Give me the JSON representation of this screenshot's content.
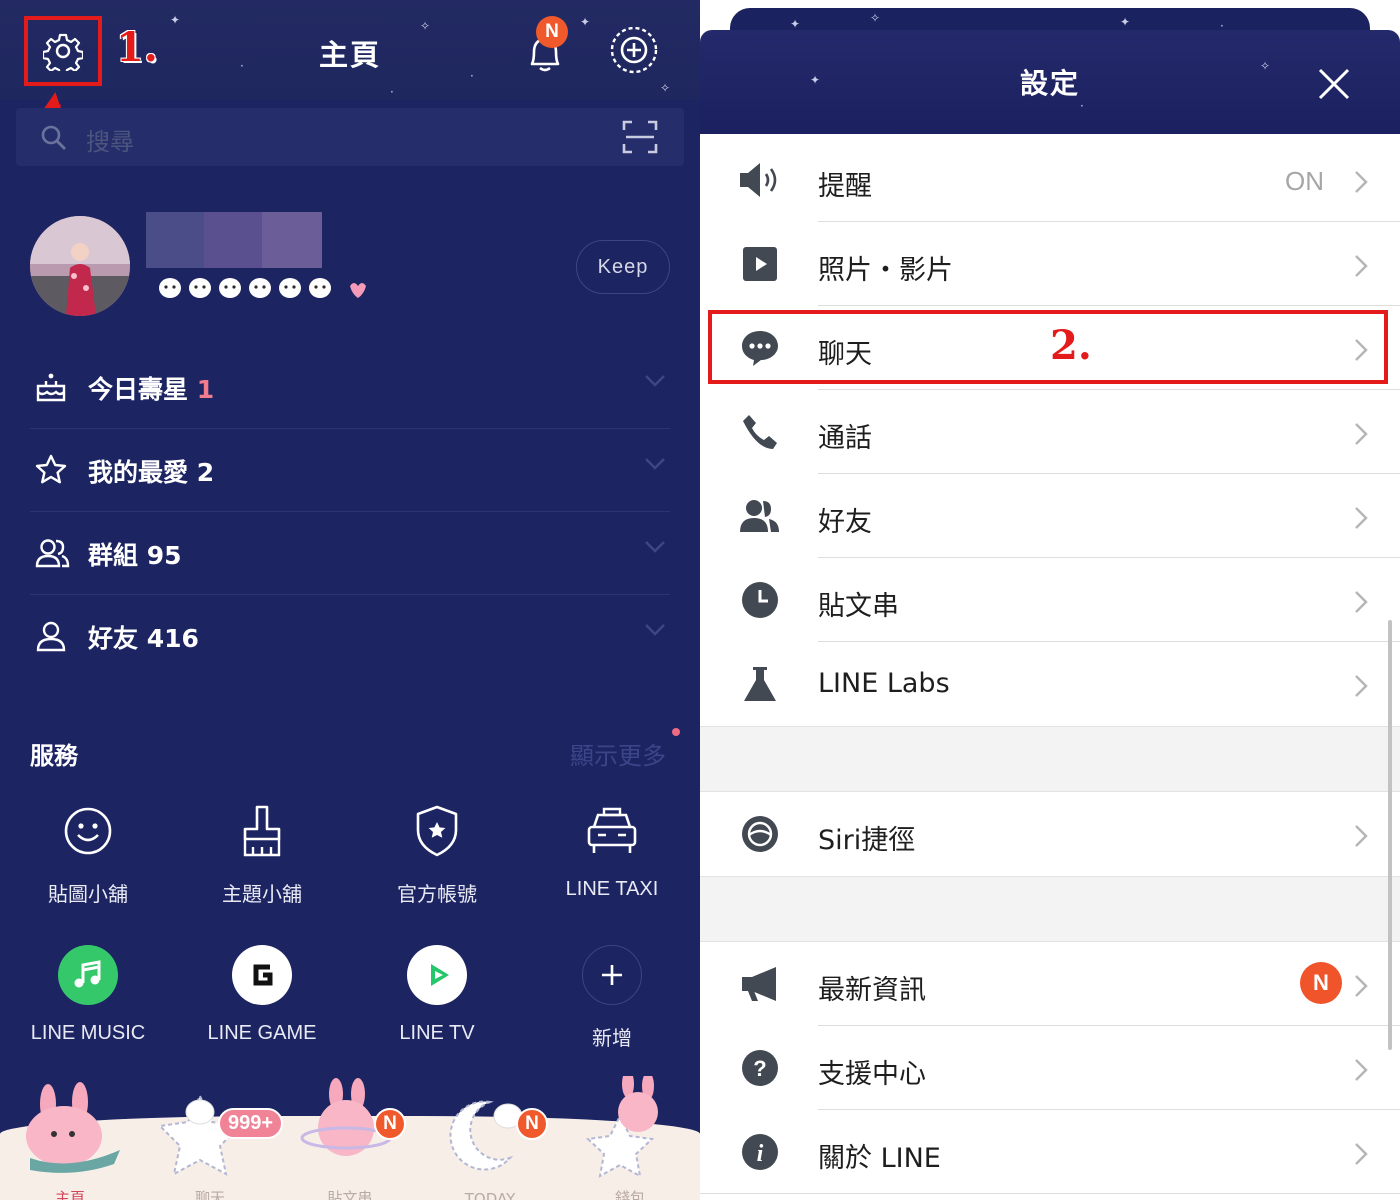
{
  "home": {
    "title": "主頁",
    "step1_label": "1.",
    "notification_badge": "N",
    "search": {
      "placeholder": "搜尋"
    },
    "profile": {
      "keep_label": "Keep"
    },
    "sections": [
      {
        "label": "今日壽星",
        "count": "1",
        "icon": "cake-icon"
      },
      {
        "label": "我的最愛",
        "count": "2",
        "icon": "star-icon"
      },
      {
        "label": "群組",
        "count": "95",
        "icon": "group-icon"
      },
      {
        "label": "好友",
        "count": "416",
        "icon": "person-icon"
      }
    ],
    "services": {
      "title": "服務",
      "more": "顯示更多",
      "items": [
        {
          "label": "貼圖小舖",
          "icon": "smiley-icon"
        },
        {
          "label": "主題小舖",
          "icon": "brush-icon"
        },
        {
          "label": "官方帳號",
          "icon": "shield-star-icon"
        },
        {
          "label": "LINE TAXI",
          "icon": "taxi-icon"
        },
        {
          "label": "LINE MUSIC",
          "icon": "music-note-icon"
        },
        {
          "label": "LINE GAME",
          "icon": "game-g-icon"
        },
        {
          "label": "LINE TV",
          "icon": "play-icon"
        },
        {
          "label": "新增",
          "icon": "plus-icon"
        }
      ]
    },
    "tabs": [
      {
        "label": "主頁",
        "badge": ""
      },
      {
        "label": "聊天",
        "badge": "999+"
      },
      {
        "label": "貼文串",
        "badge": "N"
      },
      {
        "label": "TODAY",
        "badge": "N"
      },
      {
        "label": "錢包",
        "badge": ""
      }
    ]
  },
  "settings": {
    "title": "設定",
    "step2_label": "2.",
    "rows": [
      {
        "label": "提醒",
        "value": "ON",
        "icon": "speaker-icon"
      },
      {
        "label": "照片・影片",
        "value": "",
        "icon": "play-square-icon"
      },
      {
        "label": "聊天",
        "value": "",
        "icon": "chat-bubble-icon"
      },
      {
        "label": "通話",
        "value": "",
        "icon": "phone-icon"
      },
      {
        "label": "好友",
        "value": "",
        "icon": "friends-icon"
      },
      {
        "label": "貼文串",
        "value": "",
        "icon": "clock-icon"
      },
      {
        "label": "LINE Labs",
        "value": "",
        "icon": "flask-icon"
      },
      {
        "label": "Siri捷徑",
        "value": "",
        "icon": "siri-icon"
      },
      {
        "label": "最新資訊",
        "value": "",
        "badge": "N",
        "icon": "megaphone-icon"
      },
      {
        "label": "支援中心",
        "value": "",
        "icon": "question-icon"
      },
      {
        "label": "關於 LINE",
        "value": "",
        "icon": "info-icon"
      }
    ]
  },
  "colors": {
    "home_bg": "#1c2462",
    "annotation_red": "#e41b1b",
    "badge_orange": "#f0592b",
    "count_pink": "#f17c8d",
    "settings_icon": "#424952"
  }
}
